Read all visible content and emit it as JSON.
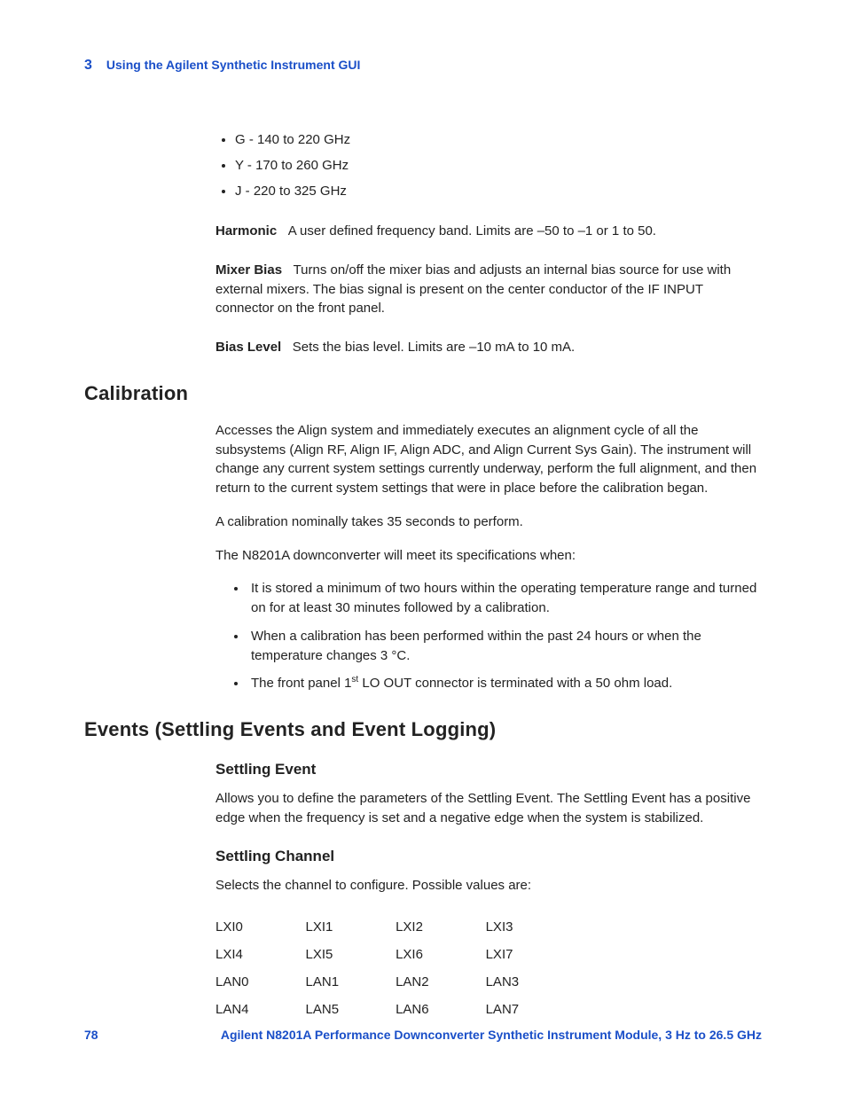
{
  "header": {
    "chapter_num": "3",
    "chapter_title": "Using the Agilent Synthetic Instrument GUI"
  },
  "band_list": [
    "G - 140 to 220 GHz",
    "Y - 170 to 260 GHz",
    "J - 220 to 325 GHz"
  ],
  "defs": {
    "harmonic_term": "Harmonic",
    "harmonic_text": "A user defined frequency band. Limits are –50 to –1 or 1 to 50.",
    "mixer_term": "Mixer Bias",
    "mixer_text": "Turns on/off the mixer bias and adjusts an internal bias source for use with external mixers. The bias signal is present on the center conductor of the IF INPUT connector on the front panel.",
    "bias_term": "Bias Level",
    "bias_text": "Sets the bias level. Limits are –10 mA to 10 mA."
  },
  "calibration": {
    "heading": "Calibration",
    "p1": "Accesses the Align system and immediately executes an alignment cycle of all the subsystems (Align RF, Align IF, Align ADC, and Align Current Sys Gain). The instrument will change any current system settings currently underway, perform the full alignment, and then return to the current system settings that were in place before the calibration began.",
    "p2": "A calibration nominally takes 35 seconds to perform.",
    "p3": "The N8201A downconverter will meet its specifications when:",
    "bullets": {
      "b1": "It is stored a minimum of two hours within the operating temperature range and turned on for at least 30 minutes followed by a calibration.",
      "b2": "When a calibration has been performed within the past 24 hours or when the temperature changes 3 °C.",
      "b3_pre": "The front panel 1",
      "b3_sup": "st",
      "b3_post": " LO OUT connector is terminated with a 50 ohm load."
    }
  },
  "events": {
    "heading": "Events (Settling Events and Event Logging)",
    "settling_event_h": "Settling Event",
    "settling_event_p": "Allows you to define the parameters of the Settling Event. The Settling Event has a positive edge when the frequency is set and a negative edge when the system is stabilized.",
    "settling_channel_h": "Settling Channel",
    "settling_channel_p": "Selects the channel to configure. Possible values are:",
    "channels": [
      [
        "LXI0",
        "LXI1",
        "LXI2",
        "LXI3"
      ],
      [
        "LXI4",
        "LXI5",
        "LXI6",
        "LXI7"
      ],
      [
        "LAN0",
        "LAN1",
        "LAN2",
        "LAN3"
      ],
      [
        "LAN4",
        "LAN5",
        "LAN6",
        "LAN7"
      ]
    ]
  },
  "footer": {
    "page": "78",
    "title": "Agilent N8201A Performance Downconverter Synthetic Instrument Module, 3 Hz to 26.5 GHz"
  }
}
